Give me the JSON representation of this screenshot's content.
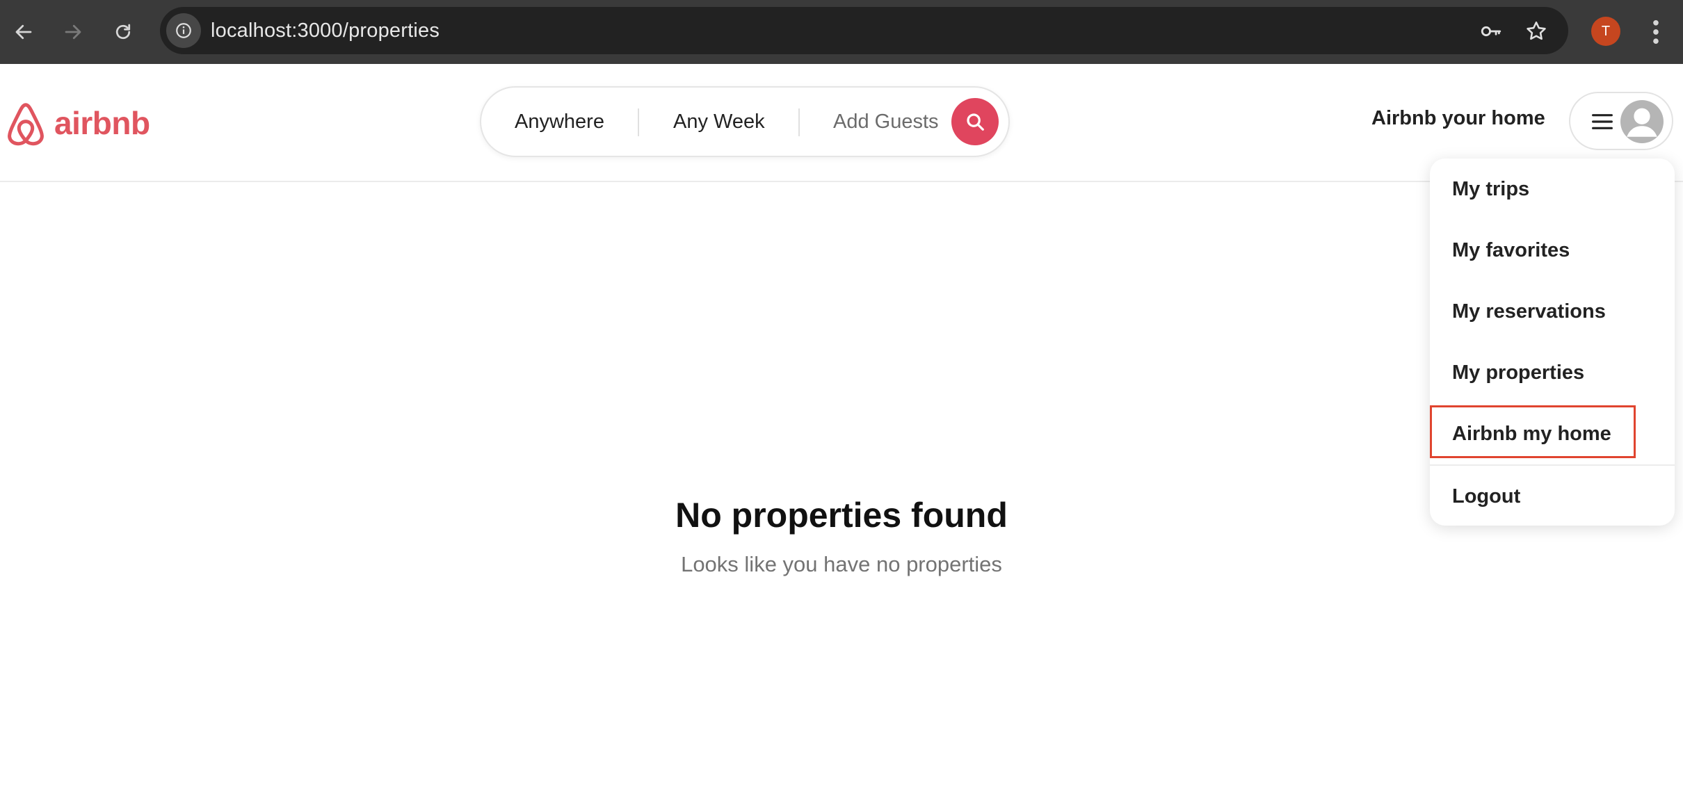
{
  "browser": {
    "url": "localhost:3000/properties",
    "profile_initial": "T"
  },
  "header": {
    "logo_text": "airbnb",
    "search": {
      "location_label": "Anywhere",
      "week_label": "Any Week",
      "guests_label": "Add Guests"
    },
    "host_link": "Airbnb your home"
  },
  "dropdown": {
    "items": [
      {
        "label": "My trips"
      },
      {
        "label": "My favorites"
      },
      {
        "label": "My reservations"
      },
      {
        "label": "My properties"
      },
      {
        "label": "Airbnb my home"
      },
      {
        "label": "Logout"
      }
    ],
    "highlighted_item": "Airbnb my home"
  },
  "empty_state": {
    "title": "No properties found",
    "subtitle": "Looks like you have no properties"
  },
  "colors": {
    "brand": "#e0555f",
    "search_button": "#e0455e",
    "highlight_border": "#e0442f",
    "profile_badge": "#c6461f"
  }
}
